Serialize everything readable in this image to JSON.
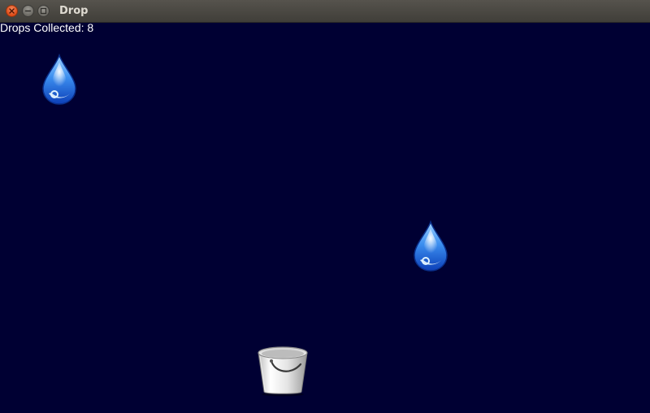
{
  "window": {
    "title": "Drop",
    "buttons": [
      "close-icon",
      "minimize-icon",
      "maximize-icon"
    ]
  },
  "hud": {
    "score_text": "Drops Collected: 8"
  },
  "colors": {
    "background": "#000033",
    "drop": "#3a8df0",
    "bucket": "#e6e6e6"
  },
  "sprites": {
    "drops": [
      "raindrop-icon",
      "raindrop-icon"
    ],
    "bucket": "bucket-icon"
  }
}
